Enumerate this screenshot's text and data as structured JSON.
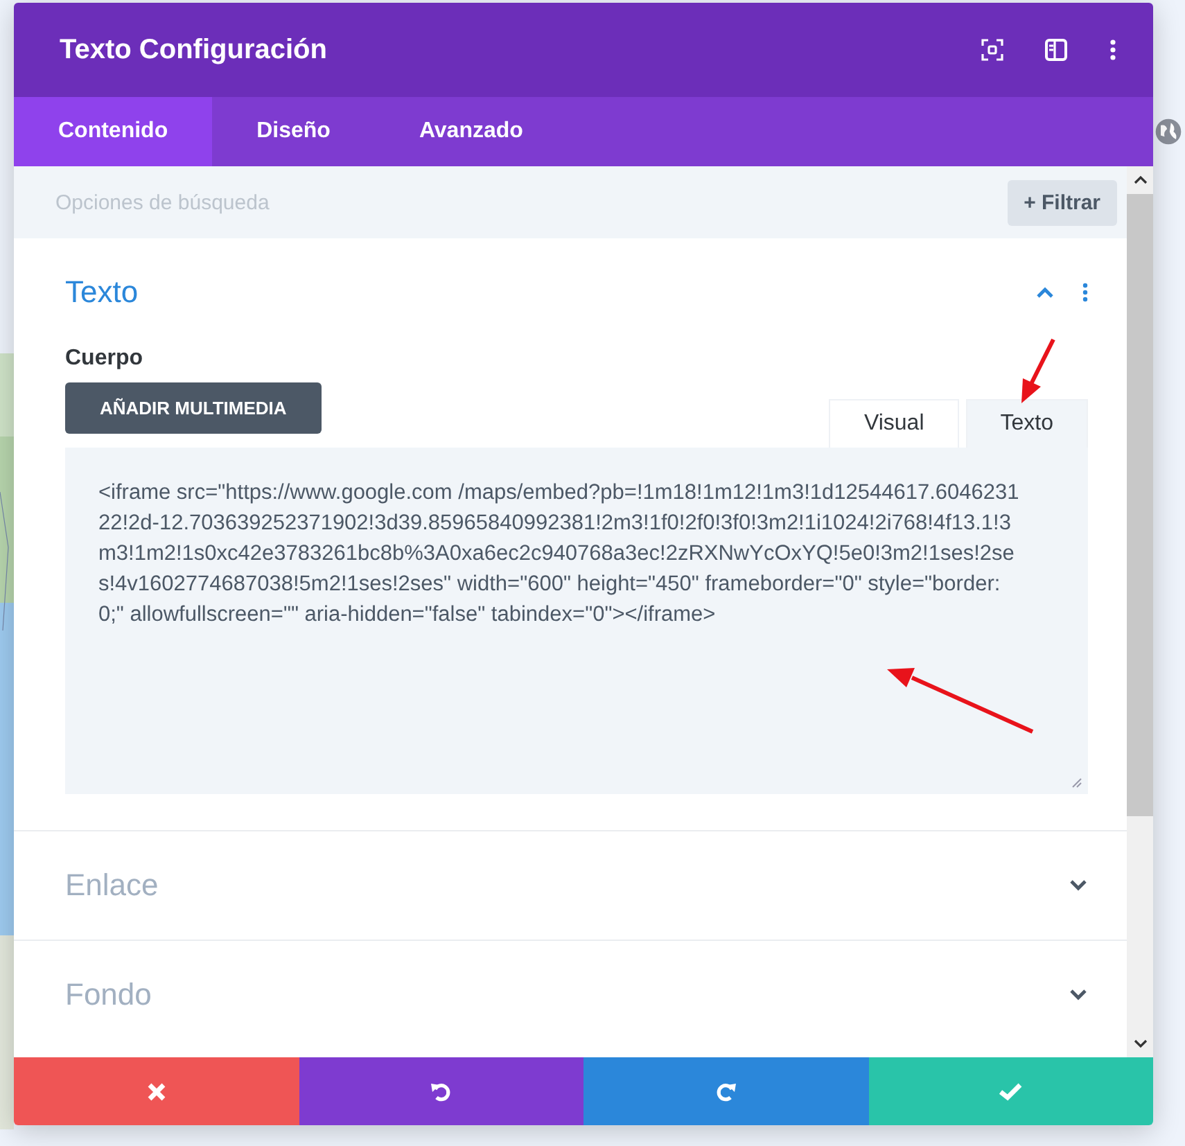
{
  "window": {
    "title": "Texto Configuración"
  },
  "tabs": [
    {
      "label": "Contenido",
      "selected": true
    },
    {
      "label": "Diseño",
      "selected": false
    },
    {
      "label": "Avanzado",
      "selected": false
    }
  ],
  "search": {
    "placeholder": "Opciones de búsqueda",
    "filter_button": "+ Filtrar"
  },
  "sections": [
    {
      "title": "Texto",
      "expanded": true,
      "field_label": "Cuerpo",
      "media_button": "AÑADIR MULTIMEDIA",
      "editor_tabs": [
        {
          "label": "Visual",
          "selected": false
        },
        {
          "label": "Texto",
          "selected": true
        }
      ],
      "code": "<iframe src=\"https://www.google.com /maps/embed?pb=!1m18!1m12!1m3!1d12544617.604623122!2d-12.703639252371902!3d39.85965840992381!2m3!1f0!2f0!3f0!3m2!1i1024!2i768!4f13.1!3m3!1m2!1s0xc42e3783261bc8b%3A0xa6ec2c940768a3ec!2zRXNwYcOxYQ!5e0!3m2!1ses!2ses!4v1602774687038!5m2!1ses!2ses\" width=\"600\" height=\"450\" frameborder=\"0\" style=\"border:0;\" allowfullscreen=\"\" aria-hidden=\"false\" tabindex=\"0\"></iframe>"
    },
    {
      "title": "Enlace",
      "expanded": false
    },
    {
      "title": "Fondo",
      "expanded": false
    }
  ],
  "footer": [
    {
      "kind": "cancel"
    },
    {
      "kind": "undo"
    },
    {
      "kind": "redo"
    },
    {
      "kind": "save"
    }
  ]
}
